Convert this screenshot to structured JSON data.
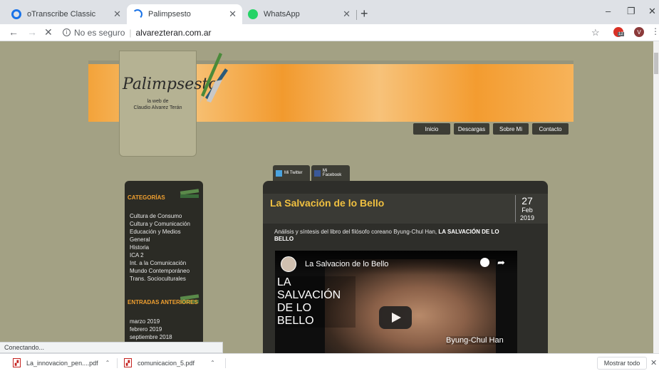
{
  "browser": {
    "tabs": [
      {
        "title": "oTranscribe Classic",
        "icon": "otranscribe-icon",
        "color": "#1a73e8"
      },
      {
        "title": "Palimpsesto",
        "icon": "loading-spinner-icon",
        "color": "#1a73e8"
      },
      {
        "title": "WhatsApp",
        "icon": "whatsapp-icon",
        "color": "#25d366"
      }
    ],
    "active_tab": 1,
    "new_tab": "+",
    "window_controls": {
      "minimize": "–",
      "restore": "❐",
      "close": "✕"
    },
    "nav": {
      "back": "←",
      "forward": "→",
      "stop": "✕"
    },
    "omnibox": {
      "security_label": "No es seguro",
      "separator": "|",
      "url": "alvarezteran.com.ar"
    },
    "bookmark_star": "☆",
    "extension2_letter": "V",
    "extension1_badge": "12",
    "menu": "⋮"
  },
  "site": {
    "logo_title": "Palimpsesto",
    "logo_subtitle_1": "la web de",
    "logo_subtitle_2": "Claudio Alvarez Terán",
    "menu": [
      "Inicio",
      "Descargas",
      "Sobre Mi",
      "Contacto"
    ],
    "social": {
      "twitter": "Mi Twitter",
      "facebook": "Mi Facebook"
    },
    "sidebar": {
      "categories_heading": "CATEGORÍAS",
      "categories": [
        "Cultura de Consumo",
        "Cultura y Comunicación",
        "Educación y Medios",
        "General",
        "Historia",
        "ICA 2",
        "Int. a la Comunicación",
        "Mundo Contemporáneo",
        "Trans. Socioculturales"
      ],
      "archive_heading": "ENTRADAS ANTERIORES",
      "archive": [
        "marzo 2019",
        "febrero 2019",
        "septiembre 2018"
      ]
    },
    "post": {
      "title": "La Salvación de lo Bello",
      "day": "27",
      "month": "Feb",
      "year": "2019",
      "intro": "Análisis y síntesis del libro del filósofo coreano Byung-Chul Han,",
      "intro_bold": "LA SALVACIÓN DE LO BELLO",
      "video": {
        "title": "La Salvacion de lo Bello",
        "big_text": [
          "LA",
          "SALVACIÓN",
          "DE LO",
          "BELLO"
        ],
        "caption": "Byung-Chul Han"
      }
    }
  },
  "status_text": "Conectando...",
  "downloads": {
    "items": [
      "La_innovacion_pen....pdf",
      "comunicacion_5.pdf"
    ],
    "show_all": "Mostrar todo",
    "close": "✕"
  }
}
